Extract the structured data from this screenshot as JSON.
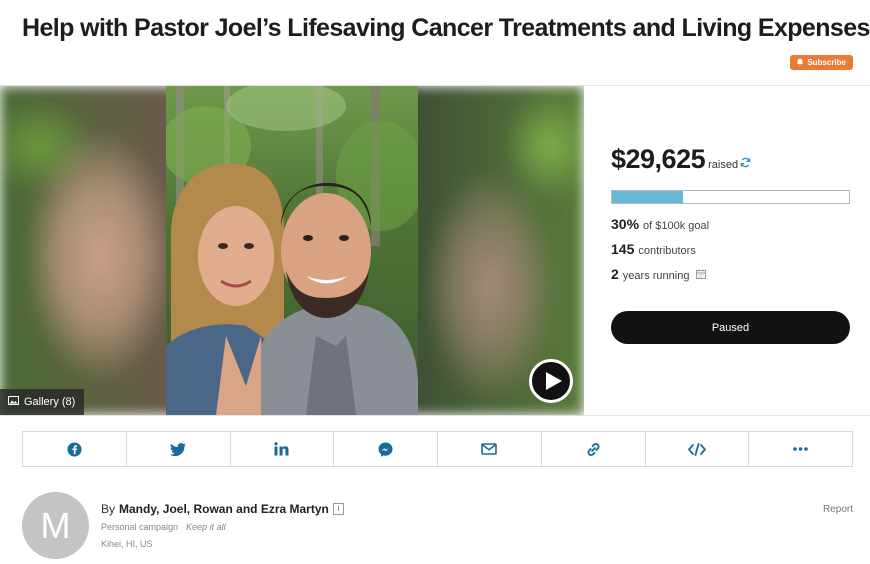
{
  "campaign": {
    "title": "Help with Pastor Joel’s Lifesaving Cancer Treatments and Living Expenses",
    "subscribe_label": "Subscribe"
  },
  "media": {
    "gallery_label": "Gallery (8)"
  },
  "funding": {
    "amount": "$29,625",
    "raised_label": "raised",
    "progress_fraction": 0.3,
    "percent": "30%",
    "goal_text": "of $100k goal",
    "contributors_count": "145",
    "contributors_label": "contributors",
    "running_count": "2",
    "running_label": "years running",
    "status_button": "Paused"
  },
  "share": {
    "buttons": [
      "facebook-icon",
      "twitter-icon",
      "linkedin-icon",
      "messenger-icon",
      "email-icon",
      "link-icon",
      "embed-icon",
      "more-icon"
    ]
  },
  "organizer": {
    "avatar_letter": "M",
    "by_prefix": "By",
    "names": "Mandy, Joel, Rowan and Ezra Martyn",
    "campaign_type": "Personal campaign",
    "fund_type": "Keep it all",
    "location": "Kihei, HI, US",
    "report_label": "Report"
  },
  "colors": {
    "accent_orange": "#ea7a37",
    "progress_blue": "#68b8d8",
    "share_icon_blue": "#1a6b98",
    "button_dark": "#121212"
  }
}
